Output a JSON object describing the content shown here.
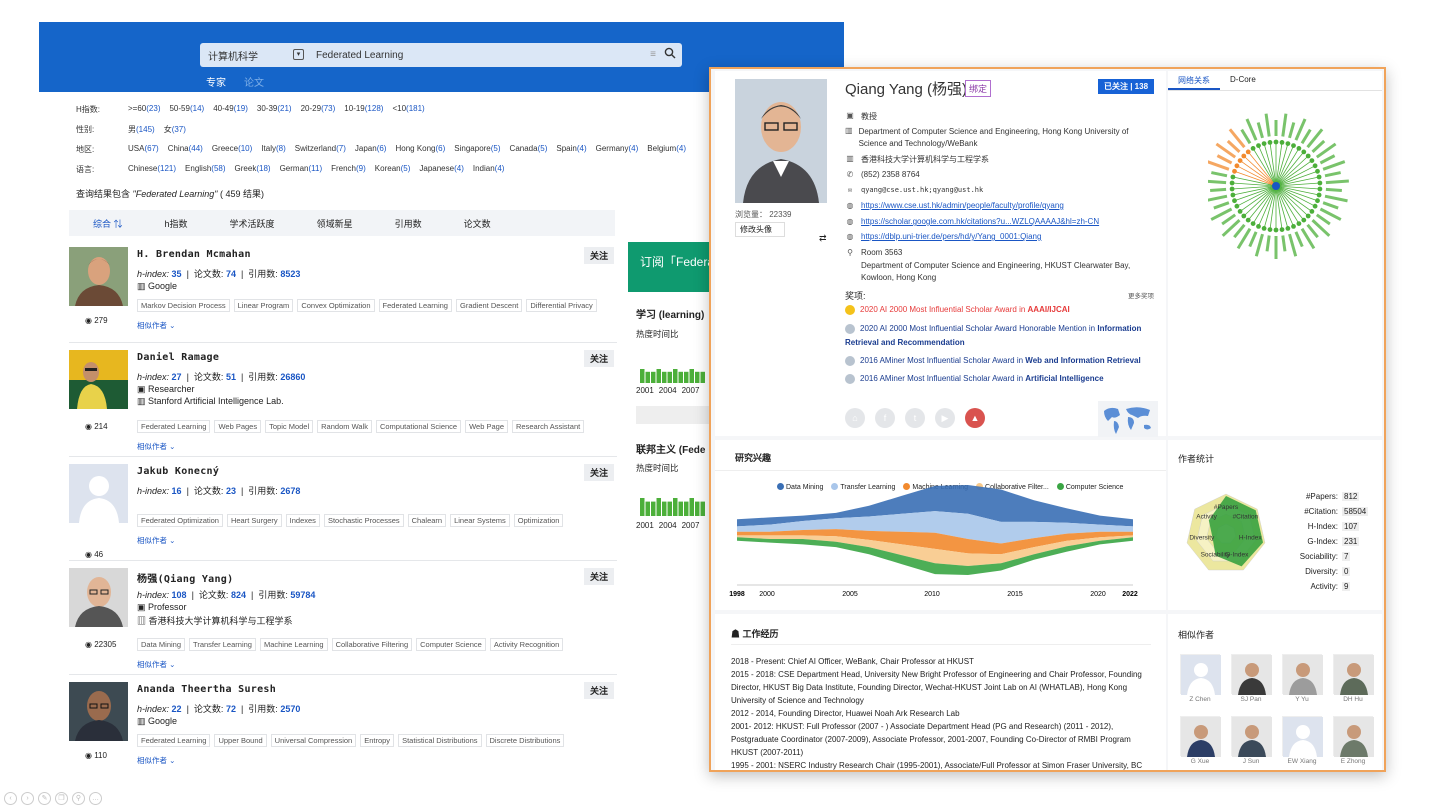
{
  "search": {
    "category": "计算机科学",
    "query": "Federated Learning",
    "tabs": [
      "专家",
      "论文"
    ]
  },
  "filters": [
    {
      "label": "H指数:",
      "items": [
        [
          ">=60",
          "(23)"
        ],
        [
          "50-59",
          "(14)"
        ],
        [
          "40-49",
          "(19)"
        ],
        [
          "30-39",
          "(21)"
        ],
        [
          "20-29",
          "(73)"
        ],
        [
          "10-19",
          "(128)"
        ],
        [
          "<10",
          "(181)"
        ]
      ]
    },
    {
      "label": "性别:",
      "items": [
        [
          "男",
          "(145)"
        ],
        [
          "女",
          "(37)"
        ]
      ]
    },
    {
      "label": "地区:",
      "items": [
        [
          "USA",
          "(67)"
        ],
        [
          "China",
          "(44)"
        ],
        [
          "Greece",
          "(10)"
        ],
        [
          "Italy",
          "(8)"
        ],
        [
          "Switzerland",
          "(7)"
        ],
        [
          "Japan",
          "(6)"
        ],
        [
          "Hong Kong",
          "(6)"
        ],
        [
          "Singapore",
          "(5)"
        ],
        [
          "Canada",
          "(5)"
        ],
        [
          "Spain",
          "(4)"
        ],
        [
          "Germany",
          "(4)"
        ],
        [
          "Belgium",
          "(4)"
        ]
      ]
    },
    {
      "label": "语言:",
      "items": [
        [
          "Chinese",
          "(121)"
        ],
        [
          "English",
          "(58)"
        ],
        [
          "Greek",
          "(18)"
        ],
        [
          "German",
          "(11)"
        ],
        [
          "French",
          "(9)"
        ],
        [
          "Korean",
          "(5)"
        ],
        [
          "Japanese",
          "(4)"
        ],
        [
          "Indian",
          "(4)"
        ]
      ]
    }
  ],
  "result_count": {
    "prefix": "查询结果包含 ",
    "query": "\"Federated Learning\"",
    "suffix": " ( 459 结果)"
  },
  "sort": [
    "综合",
    "h指数",
    "学术活跃度",
    "领域新星",
    "引用数",
    "论文数"
  ],
  "labels": {
    "follow": "关注",
    "hindex": "h-index:",
    "papers": "论文数:",
    "citations": "引用数:",
    "related": "相似作者 ⌄"
  },
  "scholars": [
    {
      "name": "H. Brendan Mcmahan",
      "h": "35",
      "papers": "74",
      "cites": "8523",
      "lines": [
        "Google"
      ],
      "tags": [
        "Markov Decision Process",
        "Linear Program",
        "Convex Optimization",
        "Federated Learning",
        "Gradient Descent",
        "Differential Privacy"
      ],
      "views": "279"
    },
    {
      "name": "Daniel Ramage",
      "h": "27",
      "papers": "51",
      "cites": "26860",
      "lines": [
        "Researcher",
        "Stanford Artificial Intelligence Lab."
      ],
      "tags": [
        "Federated Learning",
        "Web Pages",
        "Topic Model",
        "Random Walk",
        "Computational Science",
        "Web Page",
        "Research Assistant"
      ],
      "views": "214"
    },
    {
      "name": "Jakub Konecný",
      "h": "16",
      "papers": "23",
      "cites": "2678",
      "lines": [],
      "tags": [
        "Federated Optimization",
        "Heart Surgery",
        "Indexes",
        "Stochastic Processes",
        "Chalearn",
        "Linear Systems",
        "Optimization"
      ],
      "views": "46"
    },
    {
      "name": "杨强(Qiang Yang)",
      "h": "108",
      "papers": "824",
      "cites": "59784",
      "lines": [
        "Professor",
        "香港科技大学计算机科学与工程学系"
      ],
      "tags": [
        "Data Mining",
        "Transfer Learning",
        "Machine Learning",
        "Collaborative Filtering",
        "Computer Science",
        "Activity Recognition"
      ],
      "views": "22305"
    },
    {
      "name": "Ananda Theertha Suresh",
      "h": "22",
      "papers": "72",
      "cites": "2570",
      "lines": [
        "Google"
      ],
      "tags": [
        "Federated Learning",
        "Upper Bound",
        "Universal Compression",
        "Entropy",
        "Statistical Distributions",
        "Discrete Distributions"
      ],
      "views": "110"
    }
  ],
  "subscribe": {
    "head": "订阅「Federa",
    "t1": "学习 (learning)",
    "s1": "热度时间比",
    "t2": "联邦主义 (Fede",
    "s2": "热度时间比",
    "years": [
      "2001",
      "2004",
      "2007"
    ]
  },
  "profile": {
    "name": "Qiang Yang (杨强)",
    "bind": "绑定",
    "followed": "已关注 | 138",
    "views": "浏览量： 22339",
    "edit_avatar": "修改头像",
    "title": "教授",
    "dept": "Department of Computer Science and Engineering, Hong Kong University of Science and Technology/WeBank",
    "dept2": "香港科技大学计算机科学与工程学系",
    "phone": "(852) 2358 8764",
    "email": "qyang@cse.ust.hk;qyang@ust.hk",
    "links": [
      "https://www.cse.ust.hk/admin/people/faculty/profile/qyang",
      "https://scholar.google.com.hk/citations?u...WZLQAAAAJ&hl=zh-CN",
      "https://dblp.uni-trier.de/pers/hd/y/Yang_0001:Qiang"
    ],
    "room": "Room 3563",
    "address": "Department of Computer Science and Engineering, HKUST Clearwater Bay, Kowloon, Hong Kong",
    "awards_title": "奖项:",
    "awards_more": "更多奖项",
    "awards": [
      {
        "text": "2020 AI 2000 Most Influential Scholar Award in ",
        "field": "AAAI/IJCAI",
        "color": "#e63a3a"
      },
      {
        "text": "2020 AI 2000 Most Influential Scholar Award Honorable Mention in ",
        "field": "Information Retrieval and Recommendation",
        "color": "#1a3c8f"
      },
      {
        "text": "2016 AMiner Most Influential Scholar Award in ",
        "field": "Web and Information Retrieval",
        "color": "#1a3c8f"
      },
      {
        "text": "2016 AMiner Most Influential Scholar Award in ",
        "field": "Artificial Intelligence",
        "color": "#1a3c8f"
      }
    ]
  },
  "network": {
    "tabs": [
      "网络关系",
      "D-Core"
    ]
  },
  "interest": {
    "title": "研究兴趣",
    "legend": [
      {
        "name": "Data Mining",
        "color": "#3a6fb5"
      },
      {
        "name": "Transfer Learning",
        "color": "#a9c6ea"
      },
      {
        "name": "Machine Learning",
        "color": "#f28a2e"
      },
      {
        "name": "Collaborative Filter...",
        "color": "#f8c98a"
      },
      {
        "name": "Computer Science",
        "color": "#3aa544"
      }
    ],
    "years": [
      "1998",
      "2000",
      "2005",
      "2010",
      "2015",
      "2020",
      "2022"
    ]
  },
  "stats": {
    "title": "作者统计",
    "rows": [
      [
        "#Papers:",
        "812"
      ],
      [
        "#Citation:",
        "58504"
      ],
      [
        "H-Index:",
        "107"
      ],
      [
        "G-Index:",
        "231"
      ],
      [
        "Sociability:",
        "7"
      ],
      [
        "Diversity:",
        "0"
      ],
      [
        "Activity:",
        "9"
      ]
    ],
    "radar_labels": [
      "#Papers",
      "#Citation",
      "H-Index",
      "G-Index",
      "Sociability",
      "Diversity",
      "Activity"
    ]
  },
  "work": {
    "title": "工作经历",
    "lines": [
      "2018 - Present: Chief AI Officer, WeBank, Chair Professor at HKUST",
      "2015 - 2018: CSE Department Head, University New Bright Professor of Engineering and Chair Professor, Founding Director, HKUST Big Data Institute, Founding Director, Wechat-HKUST Joint Lab on AI (WHATLAB), Hong Kong University of Science and Technology",
      "2012 - 2014, Founding Director, Huawei Noah Ark Research Lab",
      "2001- 2012: HKUST: Full Professor (2007 - ) Associate Department Head (PG and Research) (2011 - 2012), Postgraduate Coordinator (2007-2009), Associate Professor, 2001-2007, Founding Co-Director of RMBI Program HKUST (2007-2011)",
      "1995 - 2001: NSERC Industry Research Chair (1995-2001), Associate/Full Professor at Simon Fraser University, BC"
    ]
  },
  "coauthors": {
    "title": "相似作者",
    "names": [
      "Z Chen",
      "SJ Pan",
      "Y Yu",
      "DH Hu",
      "G Xue",
      "J Sun",
      "EW Xiang",
      "E Zhong"
    ]
  }
}
